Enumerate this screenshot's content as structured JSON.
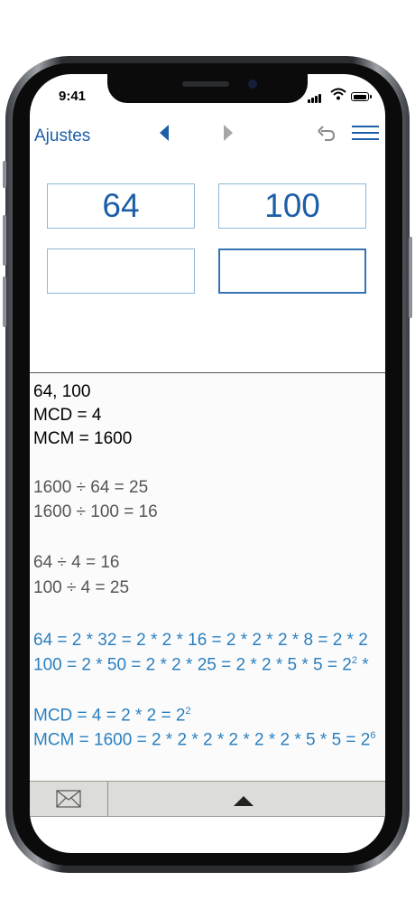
{
  "status_bar": {
    "time": "9:41"
  },
  "nav": {
    "settings_label": "Ajustes"
  },
  "inputs": {
    "first": "64",
    "second": "100",
    "third": "",
    "fourth": ""
  },
  "results": {
    "lines": [
      "64, 100",
      "MCD = 4",
      "MCM = 1600",
      "1600 ÷ 64 = 25",
      "1600 ÷ 100 = 16",
      "64 ÷ 4 = 16",
      "100 ÷ 4 = 25",
      "64 = 2 * 32 = 2 * 2 * 16 = 2 * 2 * 2 * 8 = 2 * 2",
      "100 = 2 * 50 = 2 * 2 * 25 = 2 * 2 * 5 * 5 = 2",
      "MCD = 4 = 2 * 2 = 2",
      "MCM = 1600 = 2 * 2 * 2 * 2 * 2 * 2 * 5 * 5 = 2"
    ],
    "sup_100": "2",
    "suffix_100": " *",
    "sup_mcd": "2",
    "sup_mcm": "6"
  },
  "colors": {
    "accent": "#1c5fa8",
    "steps": "#2a7fbf",
    "inactive_arrow": "#a6a6a6"
  },
  "icons": [
    "back-triangle-icon",
    "forward-triangle-icon",
    "undo-icon",
    "menu-icon",
    "mail-icon",
    "up-triangle-icon"
  ]
}
